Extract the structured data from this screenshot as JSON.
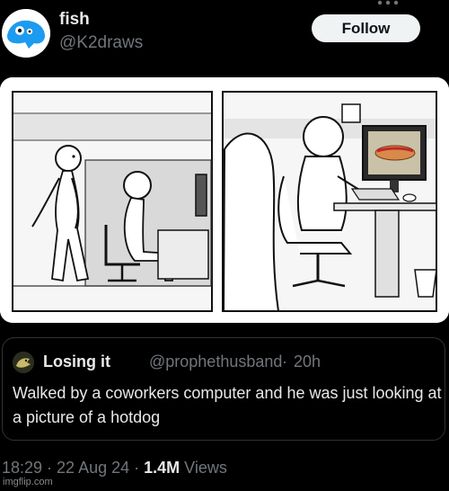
{
  "author": {
    "name": "fish",
    "handle": "@K2draws",
    "follow_label": "Follow"
  },
  "comic": {
    "icon": "comic-image"
  },
  "quoted": {
    "name": "Losing it",
    "handle": "@prophethusband",
    "separator": "·",
    "time": "20h",
    "text": "Walked by a coworkers computer and he was just looking at a picture of a hotdog"
  },
  "meta": {
    "time": "18:29",
    "sep1": " · ",
    "date": "22 Aug 24",
    "sep2": " · ",
    "views_count": "1.4M",
    "views_label": " Views"
  },
  "watermark": "imgflip.com",
  "colors": {
    "background": "#000000",
    "avatar_blue": "#1d9bf0",
    "follow_bg": "#eff3f4",
    "muted": "#71767b",
    "border": "#2f3336"
  }
}
